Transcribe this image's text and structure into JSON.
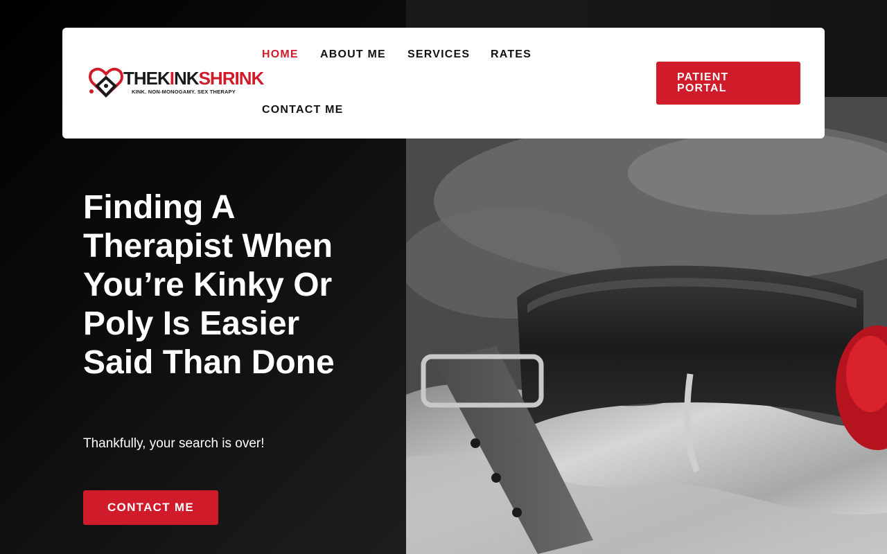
{
  "brand": {
    "name_part1": "THEK",
    "name_i": "I",
    "name_part2": "NK",
    "name_part3": "SHRINK",
    "tagline": "KINK. NON-MONOGAMY. SEX THERAPY",
    "accent_color": "#d01b2a"
  },
  "nav": {
    "items": [
      {
        "label": "HOME",
        "active": true
      },
      {
        "label": "ABOUT ME",
        "active": false
      },
      {
        "label": "SERVICES",
        "active": false
      },
      {
        "label": "RATES",
        "active": false
      },
      {
        "label": "CONTACT ME",
        "active": false
      }
    ],
    "portal_label": "PATIENT PORTAL"
  },
  "hero": {
    "title": "Finding A Therapist When You’re Kinky Or Poly Is Easier Said Than Done",
    "subtitle": "Thankfully, your search is over!",
    "cta_label": "CONTACT ME",
    "image_subject": "leather collar with rose on satin"
  }
}
